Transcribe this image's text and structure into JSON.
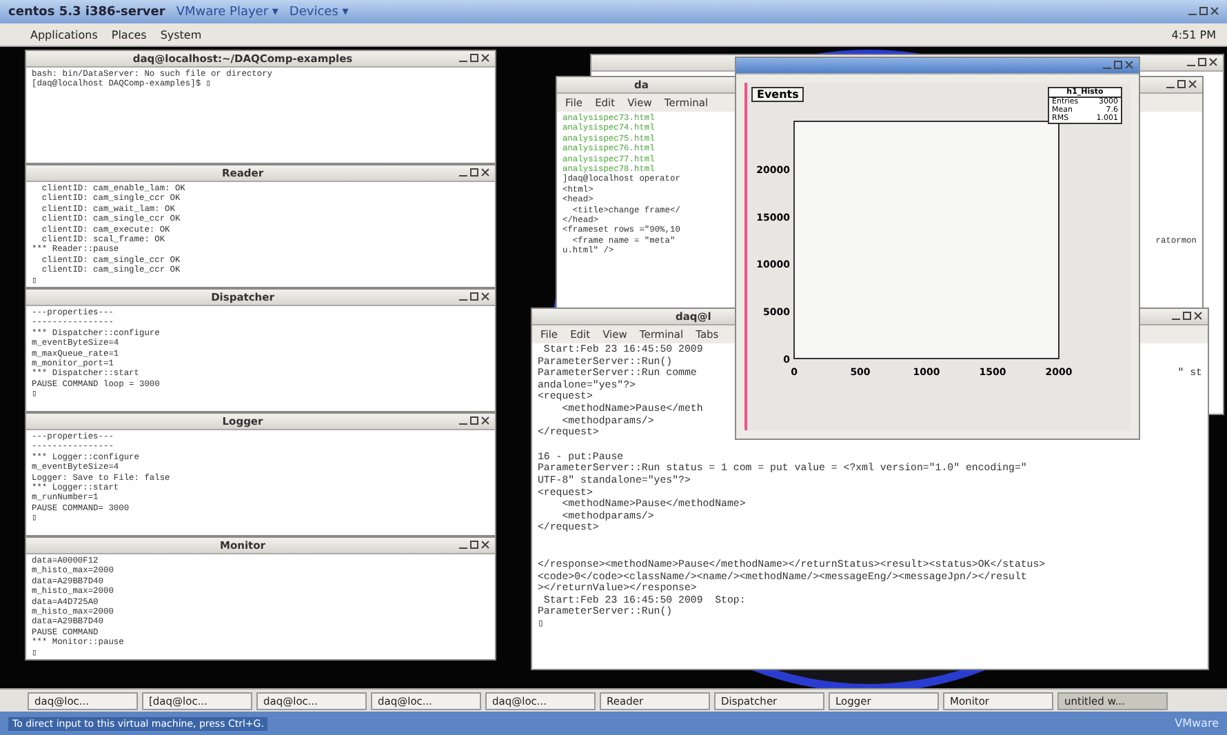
{
  "vm_window": {
    "title": "centos 5.3 i386-server",
    "menus": [
      "VMware Player ▾",
      "Devices ▾"
    ]
  },
  "panel": {
    "menus": [
      "Applications",
      "Places",
      "System"
    ],
    "clock": "4:51 PM"
  },
  "left_terminals": [
    {
      "title": "daq@localhost:~/DAQComp-examples",
      "lines": [
        "bash: bin/DataServer: No such file or directory",
        "[daq@localhost DAQComp-examples]$ ▯"
      ]
    },
    {
      "title": "Reader",
      "lines": [
        "  clientID: cam_enable_lam: OK",
        "  clientID: cam_single_ccr OK",
        "  clientID: cam_wait_lam: OK",
        "  clientID: cam_single_ccr OK",
        "  clientID: cam_execute: OK",
        "  clientID: scal_frame: OK",
        "*** Reader::pause",
        "  clientID: cam_single_ccr OK",
        "  clientID: cam_single_ccr OK",
        "▯"
      ]
    },
    {
      "title": "Dispatcher",
      "lines": [
        "---properties---",
        "----------------",
        "*** Dispatcher::configure",
        "m_eventByteSize=4",
        "m_maxQueue_rate=1",
        "m_monitor_port=1",
        "*** Dispatcher::start",
        "PAUSE COMMAND loop = 3000",
        "▯"
      ]
    },
    {
      "title": "Logger",
      "lines": [
        "---properties---",
        "----------------",
        "*** Logger::configure",
        "m_eventByteSize=4",
        "Logger: Save to File: false",
        "*** Logger::start",
        "m_runNumber=1",
        "PAUSE COMMAND= 3000",
        "▯"
      ]
    },
    {
      "title": "Monitor",
      "lines": [
        "data=A0000F12",
        "m_histo_max=2000",
        "data=A29BB7D40",
        "m_histo_max=2000",
        "data=A4D725A0",
        "m_histo_max=2000",
        "data=A29BB7D40",
        "PAUSE COMMAND",
        "*** Monitor::pause",
        "▯"
      ]
    }
  ],
  "back_terminal": {
    "title": "da",
    "menus": [
      "File",
      "Edit",
      "View",
      "Terminal"
    ],
    "listing": [
      "analysispec73.html",
      "analysispec74.html",
      "analysispec75.html",
      "analysispec76.html",
      "analysispec77.html",
      "analysispec78.html"
    ],
    "lines": [
      {
        "text": "]daq@localhost operator"
      },
      {
        "text": "<html>"
      },
      {
        "text": "<head>"
      },
      {
        "text": "  <title>change frame</"
      },
      {
        "text": "</head>"
      },
      {
        "text": "<frameset rows =\"90%,10"
      },
      {
        "text": "  <frame name = \"meta\" ",
        "tail": "ratormon"
      },
      {
        "text": "u.html\" />"
      }
    ]
  },
  "front_terminal": {
    "title": "daq@l",
    "menus": [
      "File",
      "Edit",
      "View",
      "Terminal",
      "Tabs"
    ],
    "blocks": [
      [
        {
          "text": " Start:Feb 23 16:45:50 2009"
        },
        {
          "text": "ParameterServer::Run()"
        },
        {
          "text": "ParameterServer::Run comme",
          "tail": "\" st"
        },
        {
          "text": "andalone=\"yes\"?>"
        },
        {
          "text": "<request>"
        },
        {
          "text": "    <methodName>Pause</meth"
        },
        {
          "text": "    <methodparams/>"
        },
        {
          "text": "</request>"
        }
      ],
      [
        {
          "text": "16 - put:Pause"
        },
        {
          "text": "ParameterServer::Run status = 1 com = put value = <?xml version=\"1.0\" encoding=\""
        },
        {
          "text": "UTF-8\" standalone=\"yes\"?>"
        },
        {
          "text": "<request>"
        },
        {
          "text": "    <methodName>Pause</methodName>"
        },
        {
          "text": "    <methodparams/>"
        },
        {
          "text": "</request>"
        }
      ],
      [
        {
          "text": "</response><methodName>Pause</methodName></returnStatus><result><status>OK</status>"
        },
        {
          "text": "<code>0</code><className/><name/><methodName/><messageEng/><messageJpn/></result"
        },
        {
          "text": "></returnValue></response>"
        },
        {
          "text": " Start:Feb 23 16:45:50 2009  Stop:"
        },
        {
          "text": "ParameterServer::Run()"
        },
        {
          "text": "▯"
        }
      ]
    ]
  },
  "histogram_window": {
    "pad_title": "Events",
    "stats": {
      "title": "h1_Histo",
      "rows": [
        {
          "label": "Entries",
          "value": "3000"
        },
        {
          "label": "Mean",
          "value": "7.6"
        },
        {
          "label": "RMS",
          "value": "1.001"
        }
      ]
    },
    "chart_data": {
      "type": "bar",
      "xlim": [
        0,
        2000
      ],
      "ylim": [
        0,
        25000
      ],
      "xticks": [
        0,
        500,
        1000,
        1500,
        2000
      ],
      "yticks": [
        0,
        5000,
        10000,
        15000,
        20000
      ]
    }
  },
  "taskbar": [
    {
      "label": "daq@loc...",
      "selected": false
    },
    {
      "label": "[daq@loc...",
      "selected": false
    },
    {
      "label": "daq@loc...",
      "selected": false
    },
    {
      "label": "daq@loc...",
      "selected": false
    },
    {
      "label": "daq@loc...",
      "selected": false
    },
    {
      "label": "Reader",
      "selected": false
    },
    {
      "label": "Dispatcher",
      "selected": false
    },
    {
      "label": "Logger",
      "selected": false
    },
    {
      "label": "Monitor",
      "selected": false
    },
    {
      "label": "untitled w...",
      "selected": true
    }
  ],
  "status_bar": {
    "message": "To direct input to this virtual machine, press Ctrl+G.",
    "brand": "VMware"
  }
}
